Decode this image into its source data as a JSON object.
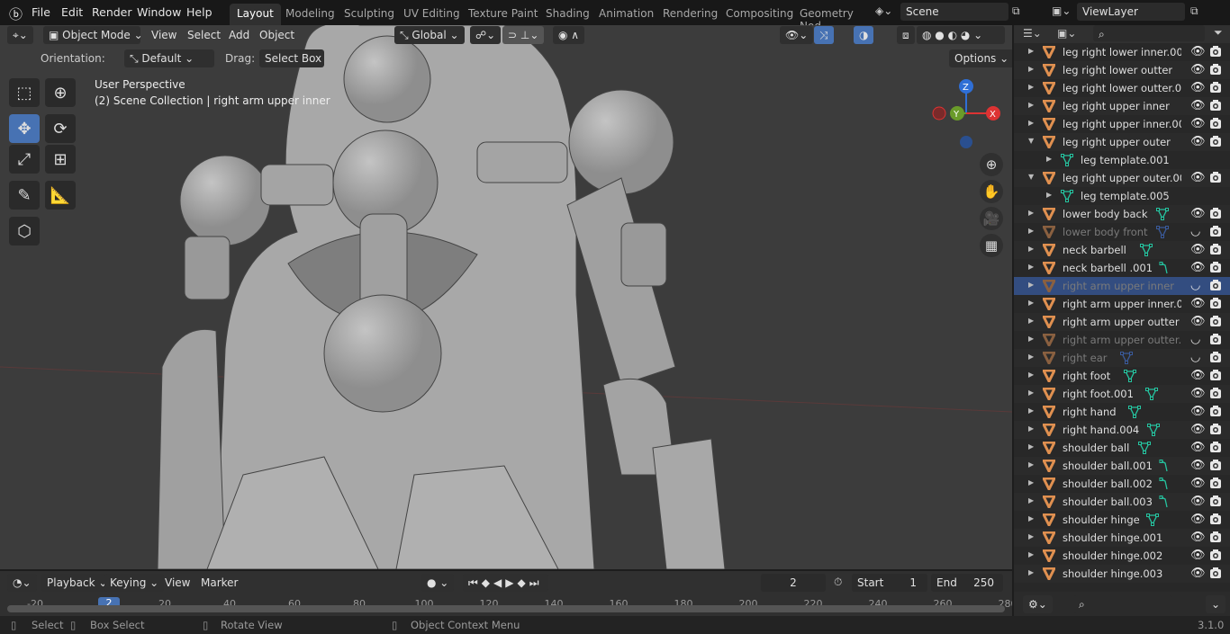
{
  "topbar": {
    "menus": [
      "File",
      "Edit",
      "Render",
      "Window",
      "Help"
    ],
    "workspaces": [
      "Layout",
      "Modeling",
      "Sculpting",
      "UV Editing",
      "Texture Paint",
      "Shading",
      "Animation",
      "Rendering",
      "Compositing",
      "Geometry Nod"
    ],
    "active_workspace": "Layout",
    "scene": "Scene",
    "view_layer": "ViewLayer"
  },
  "viewport": {
    "mode": "Object Mode",
    "menus": [
      "View",
      "Select",
      "Add",
      "Object"
    ],
    "transform_orientation": "Global",
    "tool_settings": {
      "orientation_label": "Orientation:",
      "orientation_value": "Default",
      "drag_label": "Drag:",
      "drag_value": "Select Box",
      "options": "Options"
    },
    "overlay_title": "User Perspective",
    "overlay_subtitle": "(2) Scene Collection | right arm upper inner",
    "gizmo": {
      "z": "Z",
      "y": "Y",
      "x": "X"
    }
  },
  "outliner": {
    "rows": [
      {
        "name": "leg right lower inner.00",
        "indent": 0,
        "expand": "closed",
        "mod": "",
        "dim": false,
        "sel": false,
        "hidden": false,
        "eye": true
      },
      {
        "name": "leg right lower outter",
        "indent": 0,
        "expand": "closed",
        "mod": "",
        "dim": false,
        "sel": false,
        "hidden": false,
        "eye": true
      },
      {
        "name": "leg right lower outter.0(",
        "indent": 0,
        "expand": "closed",
        "mod": "",
        "dim": false,
        "sel": false,
        "hidden": false,
        "eye": true
      },
      {
        "name": "leg right upper inner",
        "indent": 0,
        "expand": "closed",
        "mod": "",
        "dim": false,
        "sel": false,
        "hidden": false,
        "eye": true
      },
      {
        "name": "leg right upper inner.00",
        "indent": 0,
        "expand": "closed",
        "mod": "",
        "dim": false,
        "sel": false,
        "hidden": false,
        "eye": true
      },
      {
        "name": "leg right upper outer",
        "indent": 0,
        "expand": "open",
        "mod": "",
        "dim": false,
        "sel": false,
        "hidden": false,
        "eye": true
      },
      {
        "name": "leg template.001",
        "indent": 1,
        "expand": "closed",
        "mod": "",
        "dim": false,
        "sel": false,
        "hidden": false,
        "eye": false
      },
      {
        "name": "leg right upper outer.00",
        "indent": 0,
        "expand": "open",
        "mod": "",
        "dim": false,
        "sel": false,
        "hidden": false,
        "eye": true
      },
      {
        "name": "leg template.005",
        "indent": 1,
        "expand": "closed",
        "mod": "",
        "dim": false,
        "sel": false,
        "hidden": false,
        "eye": false
      },
      {
        "name": "lower body back",
        "indent": 0,
        "expand": "closed",
        "mod": "mesh",
        "dim": false,
        "sel": false,
        "hidden": false,
        "eye": true
      },
      {
        "name": "lower body front",
        "indent": 0,
        "expand": "closed",
        "mod": "mesh",
        "dim": true,
        "sel": false,
        "hidden": true,
        "eye": true
      },
      {
        "name": "neck barbell",
        "indent": 0,
        "expand": "closed",
        "mod": "mesh",
        "dim": false,
        "sel": false,
        "hidden": false,
        "eye": true
      },
      {
        "name": "neck barbell .001",
        "indent": 0,
        "expand": "closed",
        "mod": "vertex",
        "dim": false,
        "sel": false,
        "hidden": false,
        "eye": true
      },
      {
        "name": "right arm upper inner",
        "indent": 0,
        "expand": "closed",
        "mod": "",
        "dim": true,
        "sel": true,
        "hidden": true,
        "eye": true
      },
      {
        "name": "right arm upper inner.0(",
        "indent": 0,
        "expand": "closed",
        "mod": "",
        "dim": false,
        "sel": false,
        "hidden": false,
        "eye": true
      },
      {
        "name": "right arm upper outter",
        "indent": 0,
        "expand": "closed",
        "mod": "",
        "dim": false,
        "sel": false,
        "hidden": false,
        "eye": true
      },
      {
        "name": "right arm upper outter.(",
        "indent": 0,
        "expand": "closed",
        "mod": "",
        "dim": true,
        "sel": false,
        "hidden": true,
        "eye": true
      },
      {
        "name": "right ear",
        "indent": 0,
        "expand": "closed",
        "mod": "mesh",
        "dim": true,
        "sel": false,
        "hidden": true,
        "eye": true
      },
      {
        "name": "right foot",
        "indent": 0,
        "expand": "closed",
        "mod": "mesh",
        "dim": false,
        "sel": false,
        "hidden": false,
        "eye": true
      },
      {
        "name": "right foot.001",
        "indent": 0,
        "expand": "closed",
        "mod": "mesh",
        "dim": false,
        "sel": false,
        "hidden": false,
        "eye": true
      },
      {
        "name": "right hand",
        "indent": 0,
        "expand": "closed",
        "mod": "mesh",
        "dim": false,
        "sel": false,
        "hidden": false,
        "eye": true
      },
      {
        "name": "right hand.004",
        "indent": 0,
        "expand": "closed",
        "mod": "mesh",
        "dim": false,
        "sel": false,
        "hidden": false,
        "eye": true
      },
      {
        "name": "shoulder ball",
        "indent": 0,
        "expand": "closed",
        "mod": "mesh",
        "dim": false,
        "sel": false,
        "hidden": false,
        "eye": true
      },
      {
        "name": "shoulder ball.001",
        "indent": 0,
        "expand": "closed",
        "mod": "vertex",
        "dim": false,
        "sel": false,
        "hidden": false,
        "eye": true
      },
      {
        "name": "shoulder ball.002",
        "indent": 0,
        "expand": "closed",
        "mod": "vertex",
        "dim": false,
        "sel": false,
        "hidden": false,
        "eye": true
      },
      {
        "name": "shoulder ball.003",
        "indent": 0,
        "expand": "closed",
        "mod": "vertex",
        "dim": false,
        "sel": false,
        "hidden": false,
        "eye": true
      },
      {
        "name": "shoulder hinge",
        "indent": 0,
        "expand": "closed",
        "mod": "mesh",
        "dim": false,
        "sel": false,
        "hidden": false,
        "eye": true
      },
      {
        "name": "shoulder hinge.001",
        "indent": 0,
        "expand": "closed",
        "mod": "",
        "dim": false,
        "sel": false,
        "hidden": false,
        "eye": true
      },
      {
        "name": "shoulder hinge.002",
        "indent": 0,
        "expand": "closed",
        "mod": "",
        "dim": false,
        "sel": false,
        "hidden": false,
        "eye": true
      },
      {
        "name": "shoulder hinge.003",
        "indent": 0,
        "expand": "closed",
        "mod": "",
        "dim": false,
        "sel": false,
        "hidden": false,
        "eye": true
      }
    ]
  },
  "timeline": {
    "menus": [
      "Playback",
      "Keying",
      "View",
      "Marker"
    ],
    "current_frame": "2",
    "start_label": "Start",
    "start": "1",
    "end_label": "End",
    "end": "250",
    "ticks": [
      "-20",
      "20",
      "40",
      "60",
      "80",
      "100",
      "120",
      "140",
      "160",
      "180",
      "200",
      "220",
      "240",
      "260",
      "280"
    ]
  },
  "statusbar": {
    "items": [
      "Select",
      "Box Select",
      "Rotate View",
      "Object Context Menu"
    ],
    "version": "3.1.0"
  },
  "colors": {
    "accent": "#4772b3",
    "object_icon": "#e09050",
    "mesh_data": "#25c4a0",
    "selected_row": "#334d80"
  }
}
